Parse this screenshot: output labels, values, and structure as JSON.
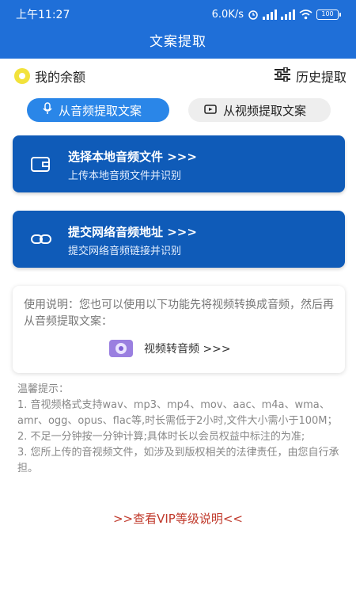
{
  "status_bar": {
    "time": "上午11:27",
    "net_speed": "6.0K/s",
    "battery": "100"
  },
  "header": {
    "title": "文案提取"
  },
  "top_row": {
    "balance_label": "我的余额",
    "history_label": "历史提取"
  },
  "tabs": [
    {
      "label": "从音频提取文案",
      "active": true
    },
    {
      "label": "从视频提取文案",
      "active": false
    }
  ],
  "cards": [
    {
      "title": "选择本地音频文件 >>>",
      "subtitle": "上传本地音频文件并识别",
      "icon": "wallet-icon"
    },
    {
      "title": "提交网络音频地址 >>>",
      "subtitle": "提交网络音频链接并识别",
      "icon": "link-icon"
    }
  ],
  "info": {
    "text": "使用说明：您也可以使用以下功能先将视频转换成音频，然后再从音频提取文案：",
    "convert_label": "视频转音频 >>>"
  },
  "tips": {
    "title": "温馨提示：",
    "lines": [
      "1. 音视频格式支持wav、mp3、mp4、mov、aac、m4a、wma、amr、ogg、opus、flac等,时长需低于2小时,文件大小需小于100M；",
      "2. 不足一分钟按一分钟计算;具体时长以会员权益中标注的为准;",
      "3. 您所上传的音视频文件，如涉及到版权相关的法律责任，由您自行承担。"
    ]
  },
  "vip_link": ">>查看VIP等级说明<<",
  "colors": {
    "header": "#1f6fd8",
    "card": "#0f5bb8",
    "active_tab": "#2a86e8",
    "vip_link": "#c0392b"
  }
}
